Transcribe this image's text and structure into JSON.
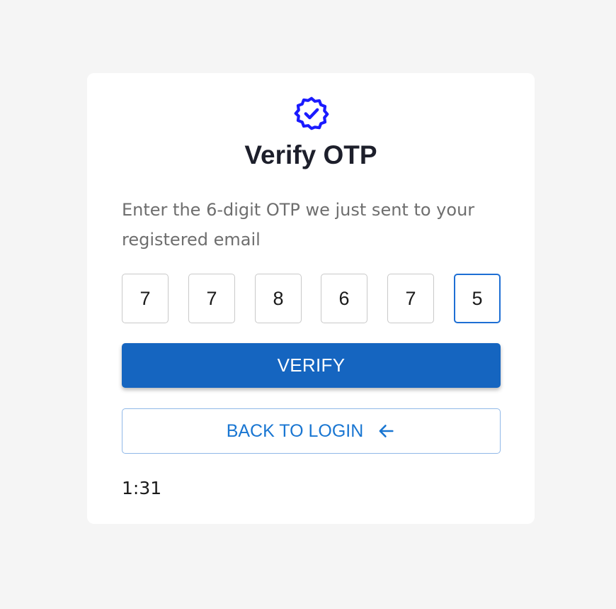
{
  "card": {
    "icon": "verified-badge-icon",
    "title": "Verify OTP",
    "subtitle": "Enter the 6-digit OTP we just sent to your registered email"
  },
  "otp": {
    "digits": [
      "7",
      "7",
      "8",
      "6",
      "7",
      "5"
    ],
    "focused_index": 5
  },
  "buttons": {
    "verify_label": "VERIFY",
    "back_label": "BACK TO LOGIN",
    "back_icon": "arrow-left-icon"
  },
  "timer": {
    "value": "1:31"
  },
  "colors": {
    "accent": "#1565c0",
    "icon": "#1a1aff",
    "link": "#1976d2",
    "background": "#f5f5f5"
  }
}
